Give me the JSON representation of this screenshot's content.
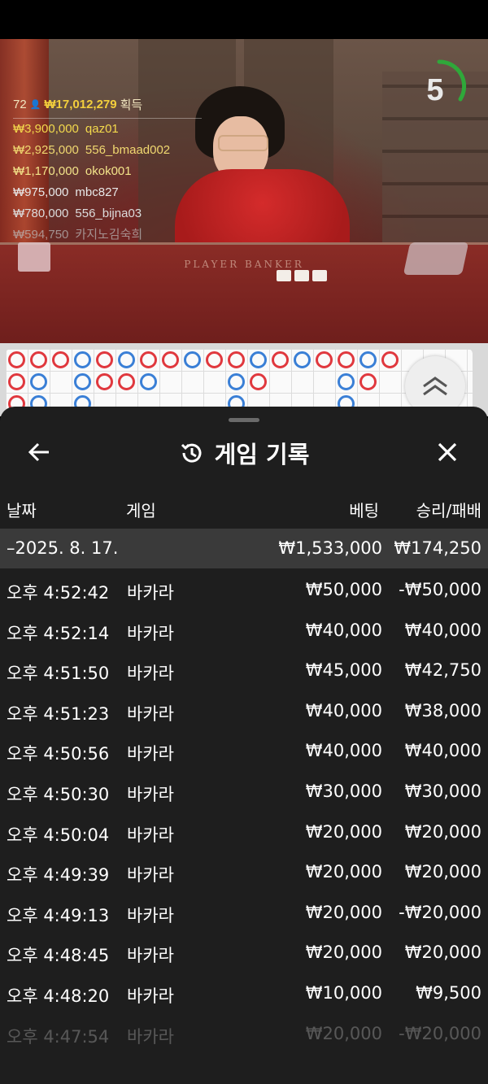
{
  "live": {
    "timer": "5",
    "winners": {
      "count": "72",
      "total": "₩17,012,279",
      "suffix": "획득",
      "list": [
        {
          "amount": "₩3,900,000",
          "user": "qaz01"
        },
        {
          "amount": "₩2,925,000",
          "user": "556_bmaad002"
        },
        {
          "amount": "₩1,170,000",
          "user": "okok001"
        },
        {
          "amount": "₩975,000",
          "user": "mbc827"
        },
        {
          "amount": "₩780,000",
          "user": "556_bijna03"
        },
        {
          "amount": "₩594,750",
          "user": "카지노김숙희"
        }
      ]
    },
    "felt_labels": "PLAYER      BANKER"
  },
  "roadmap": {
    "colors": {
      "banker": "#e0383e",
      "player": "#3a7fd6"
    }
  },
  "history": {
    "title": "게임 기록",
    "columns": {
      "date": "날짜",
      "game": "게임",
      "bet": "베팅",
      "result": "승리/패배"
    },
    "day": {
      "date": "–2025. 8. 17.",
      "bet": "₩1,533,000",
      "result": "₩174,250"
    },
    "rows": [
      {
        "time": "오후 4:52:42",
        "game": "바카라",
        "bet": "₩50,000",
        "result": "-₩50,000"
      },
      {
        "time": "오후 4:52:14",
        "game": "바카라",
        "bet": "₩40,000",
        "result": "₩40,000"
      },
      {
        "time": "오후 4:51:50",
        "game": "바카라",
        "bet": "₩45,000",
        "result": "₩42,750"
      },
      {
        "time": "오후 4:51:23",
        "game": "바카라",
        "bet": "₩40,000",
        "result": "₩38,000"
      },
      {
        "time": "오후 4:50:56",
        "game": "바카라",
        "bet": "₩40,000",
        "result": "₩40,000"
      },
      {
        "time": "오후 4:50:30",
        "game": "바카라",
        "bet": "₩30,000",
        "result": "₩30,000"
      },
      {
        "time": "오후 4:50:04",
        "game": "바카라",
        "bet": "₩20,000",
        "result": "₩20,000"
      },
      {
        "time": "오후 4:49:39",
        "game": "바카라",
        "bet": "₩20,000",
        "result": "₩20,000"
      },
      {
        "time": "오후 4:49:13",
        "game": "바카라",
        "bet": "₩20,000",
        "result": "-₩20,000"
      },
      {
        "time": "오후 4:48:45",
        "game": "바카라",
        "bet": "₩20,000",
        "result": "₩20,000"
      },
      {
        "time": "오후 4:48:20",
        "game": "바카라",
        "bet": "₩10,000",
        "result": "₩9,500"
      },
      {
        "time": "오후 4:47:54",
        "game": "바카라",
        "bet": "₩20,000",
        "result": "-₩20,000"
      }
    ]
  }
}
